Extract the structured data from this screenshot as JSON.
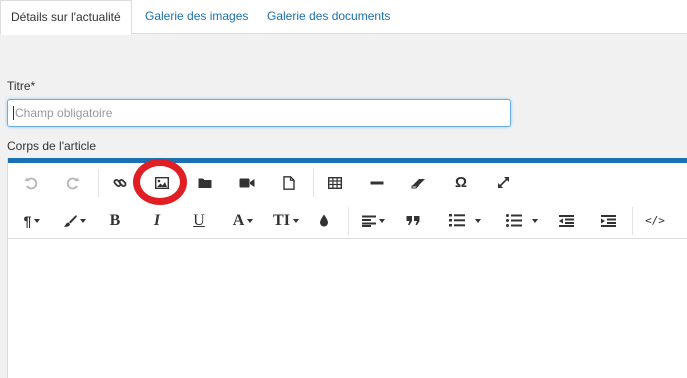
{
  "tabs": [
    {
      "label": "Détails sur l'actualité",
      "active": true
    },
    {
      "label": "Galerie des images",
      "active": false
    },
    {
      "label": "Galerie des documents",
      "active": false
    }
  ],
  "form": {
    "title_label": "Titre*",
    "title_placeholder": "Champ obligatoire",
    "title_value": "",
    "body_label": "Corps de l'article"
  },
  "toolbar": {
    "row1": [
      "undo-icon",
      "redo-icon",
      "link-icon",
      "image-icon",
      "folder-icon",
      "video-icon",
      "file-icon",
      "table-icon",
      "horizontal-rule-icon",
      "eraser-icon",
      "omega-icon",
      "fullscreen-icon"
    ],
    "row2": [
      "paragraph-icon",
      "brush-icon",
      "bold",
      "italic",
      "underline",
      "font-color",
      "font-size",
      "ink-drop-icon",
      "align-icon",
      "quote-icon",
      "ordered-list-icon",
      "unordered-list-icon",
      "outdent-icon",
      "indent-icon",
      "code-view-icon"
    ],
    "bold_label": "B",
    "italic_label": "I",
    "underline_label": "U",
    "font_color_label": "A",
    "font_size_label": "TI",
    "omega_label": "Ω",
    "code_label": "</>",
    "paragraph_label": "¶"
  },
  "colors": {
    "accent": "#1b6fb3",
    "link": "#1a6fb3",
    "highlight": "#e01e23"
  }
}
